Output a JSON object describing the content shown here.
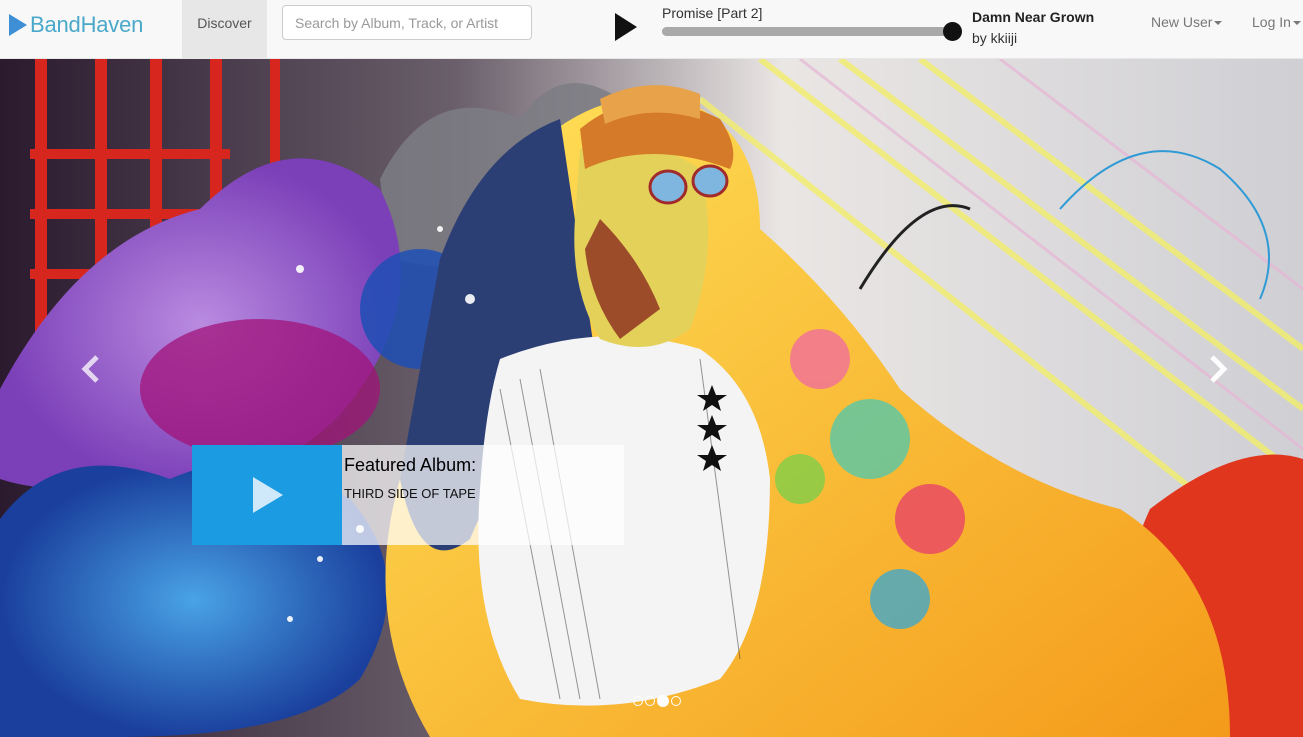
{
  "brand": {
    "name": "BandHaven",
    "logo_icon": "play-triangle-icon",
    "color": "#4aa8c9"
  },
  "nav": {
    "discover_label": "Discover",
    "new_user_label": "New User",
    "login_label": "Log In"
  },
  "search": {
    "placeholder": "Search by Album, Track, or Artist",
    "value": ""
  },
  "player": {
    "track_title": "Promise [Part 2]",
    "album_title": "Damn Near Grown",
    "artist_line": "by kkiiji",
    "progress_fraction": 1.0
  },
  "carousel": {
    "featured_heading": "Featured Album:",
    "featured_album": "THIRD SIDE OF TAPE",
    "accent_color": "#1a9be2",
    "slide_count": 4,
    "active_slide": 3
  }
}
